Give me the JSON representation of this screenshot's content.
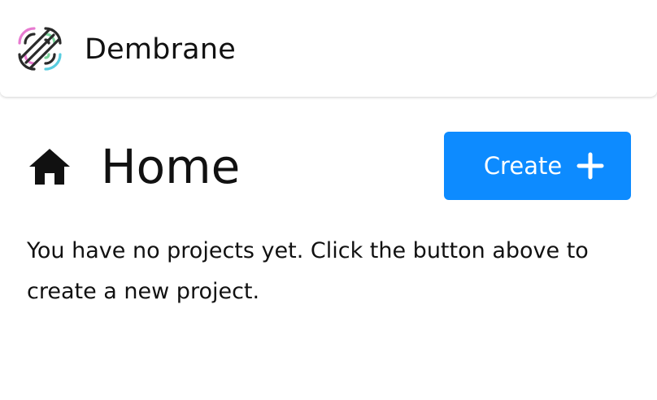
{
  "header": {
    "brand_name": "Dembrane",
    "logo_icon": "dembrane-logo-icon"
  },
  "main": {
    "title": "Home",
    "title_icon": "home-icon",
    "create_button": {
      "label": "Create",
      "icon": "plus-icon"
    },
    "empty_state": "You have no projects yet. Click the button above to create a new project."
  },
  "colors": {
    "accent": "#0D8BFF",
    "background": "#FFFFFF",
    "text": "#111111",
    "logo_pink": "#E77AD0",
    "logo_green": "#7AD39B",
    "logo_teal": "#59CDE0"
  }
}
